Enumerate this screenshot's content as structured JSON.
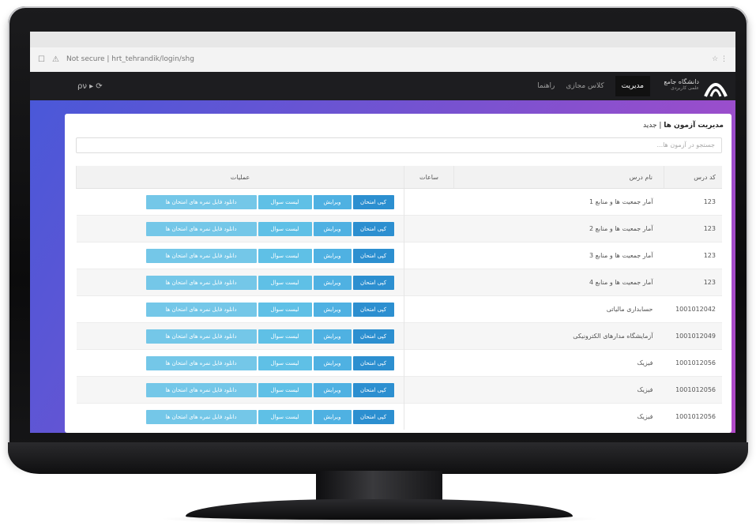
{
  "browser": {
    "url": "Not secure | hrt_tehrandik/login/shg",
    "right_icons": "☆ ⋮"
  },
  "navbar": {
    "left_text": "ρν ▸ ⟳",
    "items": [
      "راهنما",
      "کلاس مجازی",
      "مدیریت"
    ],
    "active": "مدیریت",
    "brand_line1": "دانشگاه جامع",
    "brand_line2": "علمی کاربردی"
  },
  "page": {
    "breadcrumb_prefix": "مدیریت آزمون ها",
    "breadcrumb_current": "جدید",
    "search_placeholder": "جستجو در آزمون ها..."
  },
  "table": {
    "headers": [
      "کد درس",
      "نام درس",
      "ساعات",
      "عملیات"
    ],
    "buttons": [
      "کپی امتحان",
      "ویرایش",
      "لیست سوال",
      "دانلود فایل نمره های امتحان ها"
    ],
    "rows": [
      {
        "code": "123",
        "name": "آمار جمعیت ها و منابع 1"
      },
      {
        "code": "123",
        "name": "آمار جمعیت ها و منابع 2"
      },
      {
        "code": "123",
        "name": "آمار جمعیت ها و منابع 3"
      },
      {
        "code": "123",
        "name": "آمار جمعیت ها و منابع 4"
      },
      {
        "code": "1001012042",
        "name": "حسابداری مالیاتی"
      },
      {
        "code": "1001012049",
        "name": "آزمایشگاه مدارهای الکترونیکی"
      },
      {
        "code": "1001012056",
        "name": "فیزیک"
      },
      {
        "code": "1001012056",
        "name": "فیزیک"
      },
      {
        "code": "1001012056",
        "name": "فیزیک"
      }
    ]
  }
}
